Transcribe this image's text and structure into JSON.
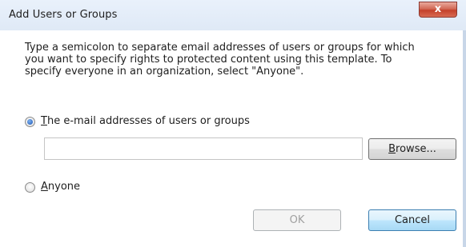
{
  "window": {
    "title": "Add Users or Groups",
    "close_label": "x"
  },
  "instructions": {
    "line1": "Type a semicolon to separate email addresses of users or groups for which",
    "line2": "you want to specify rights to protected content using this template. To",
    "line3": "specify everyone in an organization, select \"Anyone\"."
  },
  "options": {
    "email": {
      "access_key": "T",
      "rest": "he e-mail addresses of users or groups",
      "checked": true
    },
    "anyone": {
      "access_key": "A",
      "rest": "nyone",
      "checked": false
    }
  },
  "email_input": {
    "value": ""
  },
  "buttons": {
    "browse_key": "B",
    "browse_rest": "rowse...",
    "ok": "OK",
    "cancel": "Cancel"
  }
}
